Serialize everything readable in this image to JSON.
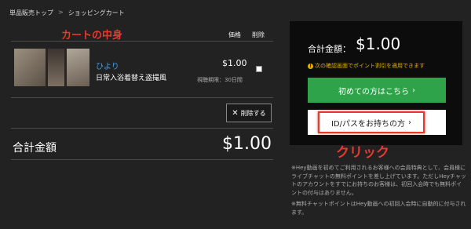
{
  "breadcrumb": {
    "items": [
      "単品販売トップ",
      "ショッピングカート"
    ],
    "separator": ">"
  },
  "annotations": {
    "cart_contents": "カートの中身",
    "click": "クリック"
  },
  "cart": {
    "columns": {
      "price": "価格",
      "delete": "削除"
    },
    "items": [
      {
        "user": "ひより",
        "title": "日常入浴着替え盗撮風",
        "price": "$1.00",
        "period": "視聴期限：30日間"
      }
    ],
    "remove_button_label": "削除する",
    "total_label": "合計金額",
    "total_value": "$1.00"
  },
  "panel": {
    "total_label": "合計金額：",
    "total_value": "$1.00",
    "note": "次の確認画面でポイント割引を適用できます",
    "first_time_button": "初めての方はこちら",
    "login_button": "ID/パスをお持ちの方"
  },
  "notes": [
    "※Hey動画を初めてご利用されるお客様への会員特典として、会員様にライブチャットの無料ポイントを差し上げています。ただしHeyチャットのアカウントをすでにお持ちのお客様は、初回入会時でも無料ポイントの付与はありません。",
    "※無料チャットポイントはHey動画への初回入会時に自動的に付与されます。"
  ],
  "colors": {
    "background": "#222222",
    "panel": "#0c0c0c",
    "accent_green": "#2fa34a",
    "annotation_red": "#e8392f",
    "link_blue": "#3f9ae0",
    "note_yellow": "#e0b000"
  }
}
